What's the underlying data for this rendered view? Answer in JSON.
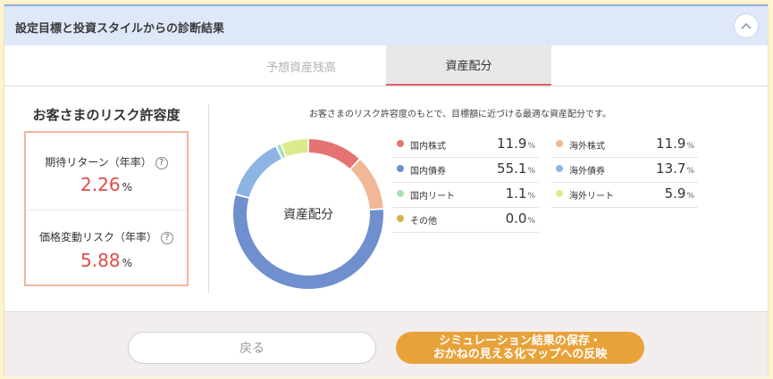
{
  "header": {
    "title": "設定目標と投資スタイルからの診断結果"
  },
  "tabs": [
    {
      "label": "予想資産残高",
      "active": false
    },
    {
      "label": "資産配分",
      "active": true
    }
  ],
  "risk": {
    "title": "お客さまのリスク許容度",
    "expected_return": {
      "label": "期待リターン（年率）",
      "value": "2.26",
      "unit": "%"
    },
    "volatility": {
      "label": "価格変動リスク（年率）",
      "value": "5.88",
      "unit": "%"
    },
    "help_glyph": "?"
  },
  "allocation": {
    "description": "お客さまのリスク許容度のもとで、目標額に近づける最適な資産配分です。",
    "donut_center": "資産配分"
  },
  "chart_data": {
    "type": "pie",
    "title": "資産配分",
    "series": [
      {
        "name": "国内株式",
        "value": 11.9,
        "color": "#e57373"
      },
      {
        "name": "海外株式",
        "value": 11.9,
        "color": "#f0b896"
      },
      {
        "name": "国内債券",
        "value": 55.1,
        "color": "#6f8fce"
      },
      {
        "name": "海外債券",
        "value": 13.7,
        "color": "#8eb4e3"
      },
      {
        "name": "国内リート",
        "value": 1.1,
        "color": "#a8e0b4"
      },
      {
        "name": "海外リート",
        "value": 5.9,
        "color": "#dcea8c"
      },
      {
        "name": "その他",
        "value": 0.0,
        "color": "#d8b04a"
      }
    ],
    "unit": "%"
  },
  "legend": {
    "left": [
      {
        "label": "国内株式",
        "value": "11.9"
      },
      {
        "label": "国内債券",
        "value": "55.1"
      },
      {
        "label": "国内リート",
        "value": "1.1"
      },
      {
        "label": "その他",
        "value": "0.0"
      }
    ],
    "right": [
      {
        "label": "海外株式",
        "value": "11.9"
      },
      {
        "label": "海外債券",
        "value": "13.7"
      },
      {
        "label": "海外リート",
        "value": "5.9"
      }
    ],
    "pct": "%"
  },
  "footer": {
    "back_label": "戻る",
    "save_line1": "シミュレーション結果の保存・",
    "save_line2": "おかねの見える化マップへの反映"
  },
  "colors": {
    "accent_red": "#e04b4b",
    "tab_underline": "#e0626b",
    "save_button": "#e8a23a",
    "header_bg": "#dfe8f8"
  }
}
